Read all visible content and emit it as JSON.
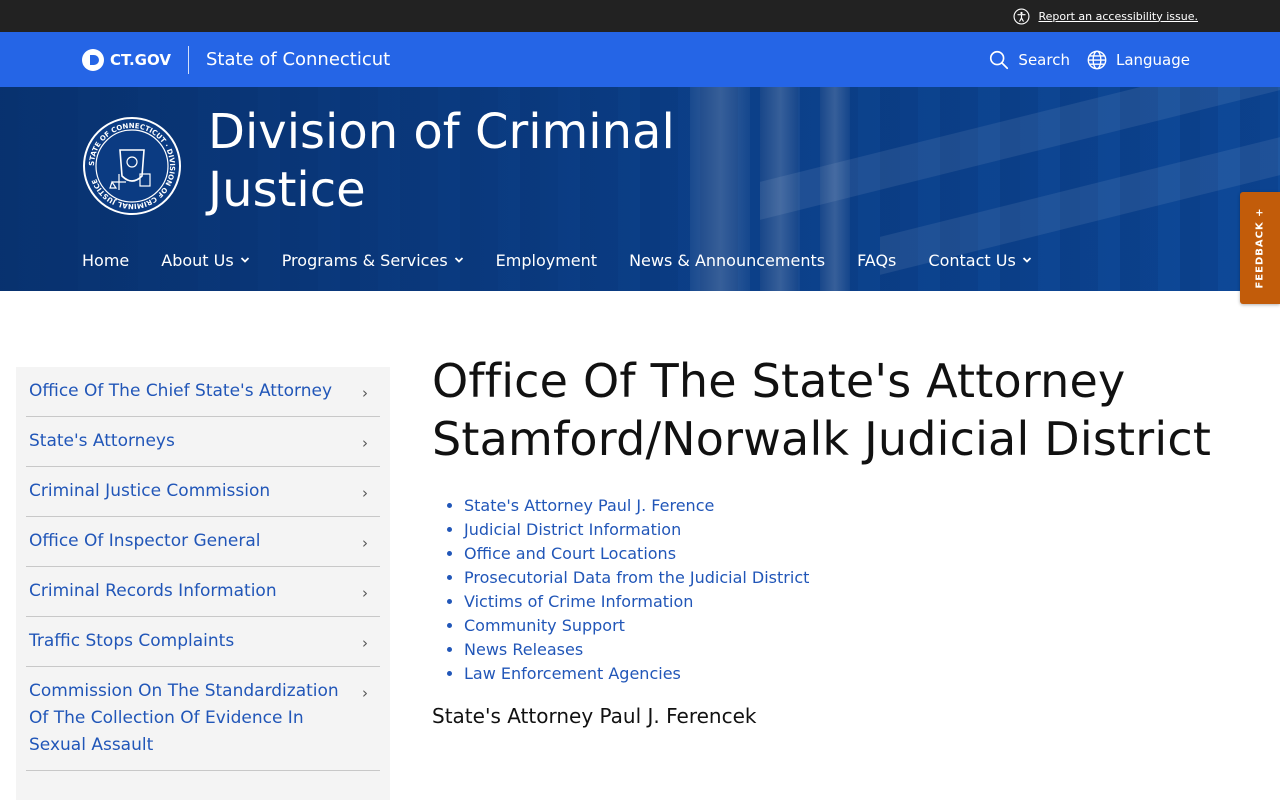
{
  "utility": {
    "accessibility_link": "Report an accessibility issue."
  },
  "gov_bar": {
    "logo_text": "CT.GOV",
    "state_name": "State of Connecticut",
    "search_label": "Search",
    "language_label": "Language"
  },
  "hero": {
    "title": "Division of Criminal Justice",
    "seal_text": "STATE OF CONNECTICUT · DIVISION OF CRIMINAL JUSTICE",
    "nav": [
      {
        "label": "Home",
        "has_dropdown": false
      },
      {
        "label": "About Us",
        "has_dropdown": true
      },
      {
        "label": "Programs & Services",
        "has_dropdown": true
      },
      {
        "label": "Employment",
        "has_dropdown": false
      },
      {
        "label": "News & Announcements",
        "has_dropdown": false
      },
      {
        "label": "FAQs",
        "has_dropdown": false
      },
      {
        "label": "Contact Us",
        "has_dropdown": true
      }
    ]
  },
  "feedback": {
    "label": "FEEDBACK +"
  },
  "sidebar": {
    "items": [
      {
        "label": "Office Of The Chief State's Attorney"
      },
      {
        "label": "State's Attorneys"
      },
      {
        "label": "Criminal Justice Commission"
      },
      {
        "label": "Office Of Inspector General"
      },
      {
        "label": "Criminal Records Information"
      },
      {
        "label": "Traffic Stops Complaints"
      },
      {
        "label": "Commission On The Standardization Of The Collection Of Evidence In Sexual Assault"
      }
    ]
  },
  "main": {
    "title": "Office Of The State's Attorney Stamford/Norwalk Judicial District",
    "links": [
      "State's Attorney Paul J. Ference",
      "Judicial District Information",
      "Office and Court Locations",
      "Prosecutorial Data from the Judicial District",
      "Victims of Crime Information",
      "Community Support",
      "News Releases",
      "Law Enforcement Agencies"
    ],
    "subheading": "State's Attorney Paul J. Ferencek"
  },
  "colors": {
    "gov_bar": "#2565e6",
    "hero_dark": "#0b3b82",
    "link": "#2156b8",
    "feedback": "#c25c0a",
    "utility_bar": "#222222"
  }
}
